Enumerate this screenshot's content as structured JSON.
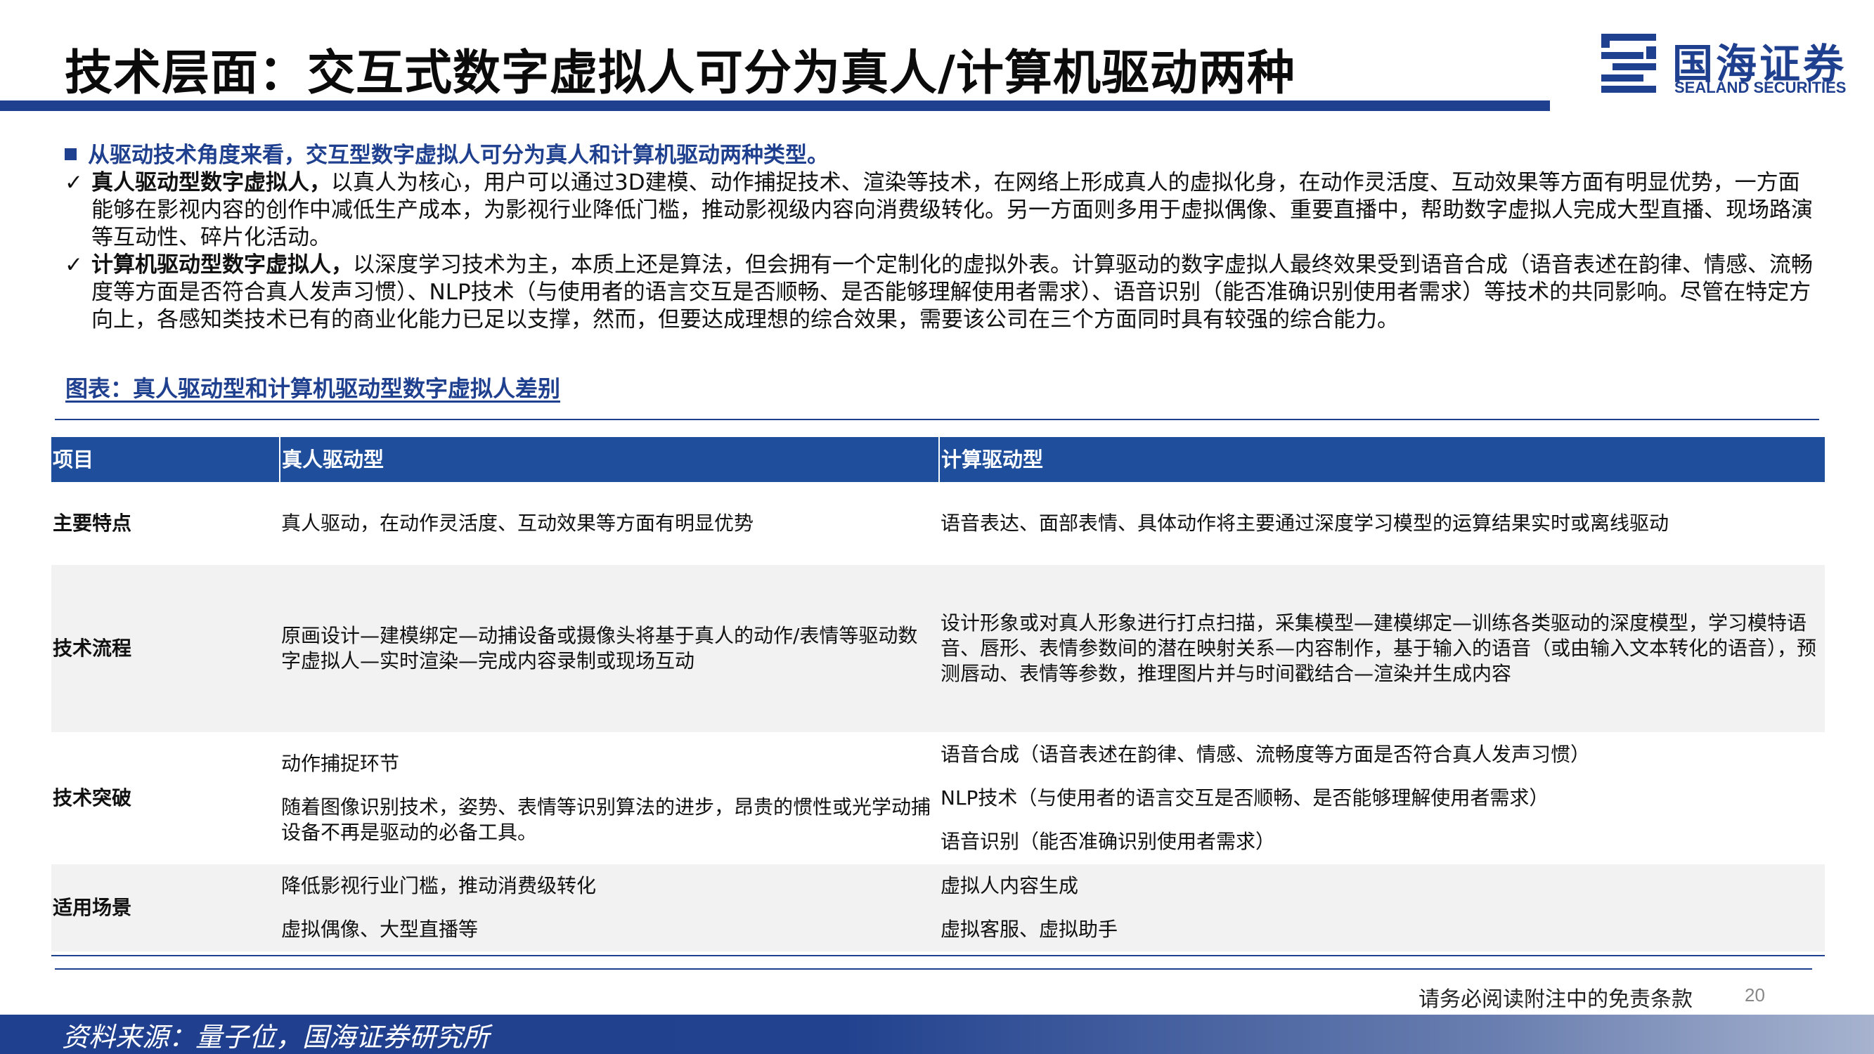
{
  "header": {
    "title": "技术层面：交互式数字虚拟人可分为真人/计算机驱动两种",
    "logo_cn": "国海证券",
    "logo_en": "SEALAND SECURITIES"
  },
  "body": {
    "lead": "从驱动技术角度来看，交互型数字虚拟人可分为真人和计算机驱动两种类型。",
    "bullets": [
      {
        "check": "✓",
        "bold": "真人驱动型数字虚拟人，",
        "text": "以真人为核心，用户可以通过3D建模、动作捕捉技术、渲染等技术，在网络上形成真人的虚拟化身，在动作灵活度、互动效果等方面有明显优势，一方面能够在影视内容的创作中减低生产成本，为影视行业降低门槛，推动影视级内容向消费级转化。另一方面则多用于虚拟偶像、重要直播中，帮助数字虚拟人完成大型直播、现场路演等互动性、碎片化活动。"
      },
      {
        "check": "✓",
        "bold": "计算机驱动型数字虚拟人，",
        "text": "以深度学习技术为主，本质上还是算法，但会拥有一个定制化的虚拟外表。计算驱动的数字虚拟人最终效果受到语音合成（语音表述在韵律、情感、流畅度等方面是否符合真人发声习惯）、NLP技术（与使用者的语言交互是否顺畅、是否能够理解使用者需求）、语音识别（能否准确识别使用者需求）等技术的共同影响。尽管在特定方向上，各感知类技术已有的商业化能力已足以支撑，然而，但要达成理想的综合效果，需要该公司在三个方面同时具有较强的综合能力。"
      }
    ]
  },
  "table": {
    "caption": "图表：真人驱动型和计算机驱动型数字虚拟人差别",
    "headers": [
      "项目",
      "真人驱动型",
      "计算驱动型"
    ],
    "rows": [
      {
        "label": "主要特点",
        "human": [
          "真人驱动，在动作灵活度、互动效果等方面有明显优势"
        ],
        "computer": [
          "语音表达、面部表情、具体动作将主要通过深度学习模型的运算结果实时或离线驱动"
        ]
      },
      {
        "label": "技术流程",
        "human": [
          "原画设计—建模绑定—动捕设备或摄像头将基于真人的动作/表情等驱动数字虚拟人—实时渲染—完成内容录制或现场互动"
        ],
        "computer": [
          "设计形象或对真人形象进行打点扫描，采集模型—建模绑定—训练各类驱动的深度模型，学习模特语音、唇形、表情参数间的潜在映射关系—内容制作，基于输入的语音（或由输入文本转化的语音），预测唇动、表情等参数，推理图片并与时间戳结合—渲染并生成内容"
        ]
      },
      {
        "label": "技术突破",
        "human": [
          "动作捕捉环节",
          "随着图像识别技术，姿势、表情等识别算法的进步，昂贵的惯性或光学动捕设备不再是驱动的必备工具。"
        ],
        "computer": [
          "语音合成（语音表述在韵律、情感、流畅度等方面是否符合真人发声习惯）",
          "NLP技术（与使用者的语言交互是否顺畅、是否能够理解使用者需求）",
          "语音识别（能否准确识别使用者需求）"
        ]
      },
      {
        "label": "适用场景",
        "human": [
          "降低影视行业门槛，推动消费级转化",
          "虚拟偶像、大型直播等"
        ],
        "computer": [
          "虚拟人内容生成",
          "虚拟客服、虚拟助手"
        ]
      }
    ]
  },
  "footer": {
    "disclaimer": "请务必阅读附注中的免责条款",
    "page_number": "20",
    "source": "资料来源：量子位，国海证券研究所"
  },
  "colors": {
    "brand": "#1f3f8f",
    "table_header": "#1f4e9c",
    "row_shade": "#f2f2f2"
  }
}
